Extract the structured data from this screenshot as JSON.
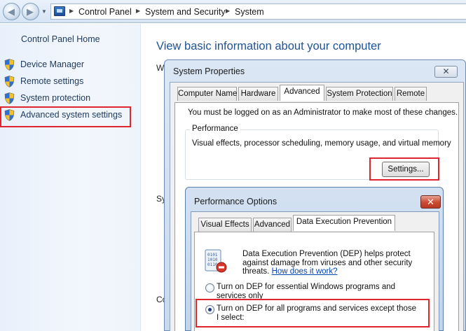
{
  "address_bar": {
    "breadcrumbs": [
      "Control Panel",
      "System and Security",
      "System"
    ]
  },
  "left_pane": {
    "home_link": "Control Panel Home",
    "tasks": [
      {
        "label": "Device Manager",
        "icon": "uac-shield-icon"
      },
      {
        "label": "Remote settings",
        "icon": "uac-shield-icon"
      },
      {
        "label": "System protection",
        "icon": "uac-shield-icon"
      },
      {
        "label": "Advanced system settings",
        "icon": "uac-shield-icon",
        "highlighted": true
      }
    ]
  },
  "main": {
    "title": "View basic information about your computer",
    "peek": [
      "W",
      "Sy",
      "Co"
    ]
  },
  "system_properties": {
    "title": "System Properties",
    "tabs": [
      "Computer Name",
      "Hardware",
      "Advanced",
      "System Protection",
      "Remote"
    ],
    "active_tab": "Advanced",
    "admin_note": "You must be logged on as an Administrator to make most of these changes.",
    "performance": {
      "group_label": "Performance",
      "description": "Visual effects, processor scheduling, memory usage, and virtual memory",
      "settings_button": "Settings..."
    }
  },
  "performance_options": {
    "title": "Performance Options",
    "tabs": [
      "Visual Effects",
      "Advanced",
      "Data Execution Prevention"
    ],
    "active_tab": "Data Execution Prevention",
    "dep_description": "Data Execution Prevention (DEP) helps protect against damage from viruses and other security threats.",
    "dep_link": "How does it work?",
    "options": [
      {
        "label": "Turn on DEP for essential Windows programs and services only",
        "selected": false
      },
      {
        "label": "Turn on DEP for all programs and services except those I select:",
        "selected": true
      }
    ]
  },
  "highlight_color": "#e0252f"
}
